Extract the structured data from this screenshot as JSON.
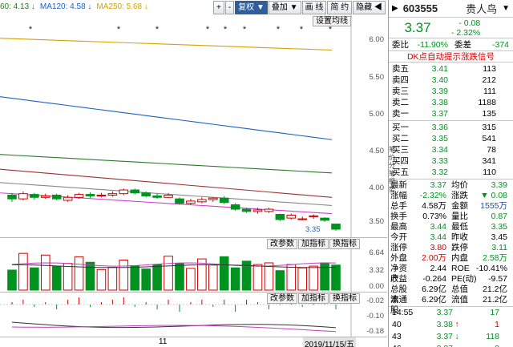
{
  "ma_legend": [
    {
      "label": "60: 4.13 ↓",
      "color": "#2b7a2b"
    },
    {
      "label": "MA120: 4.58 ↓",
      "color": "#1f60c8"
    },
    {
      "label": "MA250: 5.68 ↓",
      "color": "#d8a000"
    }
  ],
  "toolbar": [
    {
      "label": "+",
      "active": false
    },
    {
      "label": "-",
      "active": false
    },
    {
      "label": "复权 ▼",
      "active": true
    },
    {
      "label": "叠加 ▼",
      "active": false
    },
    {
      "label": "画 线",
      "active": false
    },
    {
      "label": "简 约",
      "active": false
    },
    {
      "label": "隐藏 ◀",
      "active": false
    }
  ],
  "setting_button": "设置均线",
  "price_axis": [
    "6.00",
    "5.50",
    "5.00",
    "4.50",
    "4.00",
    "3.50"
  ],
  "last_price_marker": "3.35",
  "panel_buttons": [
    "改参数",
    "加指标",
    "换指标"
  ],
  "volume_axis": [
    "6.64",
    "3.32",
    "0.00"
  ],
  "macd_axis": [
    "-0.02",
    "-0.10",
    "-0.18"
  ],
  "bottom_axis": {
    "left_label": "11",
    "date_label": "2019/11/15/五"
  },
  "stars": [
    38,
    148,
    196,
    259,
    281,
    305,
    347,
    376,
    412
  ],
  "stock": {
    "code": "603555",
    "name": "贵人鸟",
    "price": "3.37",
    "change": "- 0.08",
    "change_pct": "- 2.32%"
  },
  "committee": {
    "ratio_label": "委比",
    "ratio_value": "-11.90%",
    "diff_label": "委差",
    "diff_value": "-374"
  },
  "signal_link": "DK点自动提示涨跌信号",
  "asks": [
    {
      "label": "卖五",
      "price": "3.41",
      "volume": "113"
    },
    {
      "label": "卖四",
      "price": "3.40",
      "volume": "212"
    },
    {
      "label": "卖三",
      "price": "3.39",
      "volume": "111"
    },
    {
      "label": "卖二",
      "price": "3.38",
      "volume": "1188"
    },
    {
      "label": "卖一",
      "price": "3.37",
      "volume": "135"
    }
  ],
  "bids": [
    {
      "label": "买一",
      "price": "3.36",
      "volume": "315"
    },
    {
      "label": "买二",
      "price": "3.35",
      "volume": "541"
    },
    {
      "label": "买三",
      "price": "3.34",
      "volume": "78"
    },
    {
      "label": "买四",
      "price": "3.33",
      "volume": "341"
    },
    {
      "label": "买五",
      "price": "3.32",
      "volume": "110"
    }
  ],
  "stats": [
    {
      "l1": "最新",
      "v1": "3.37",
      "c1": "green",
      "l2": "均价",
      "v2": "3.39",
      "c2": "green"
    },
    {
      "l1": "涨幅",
      "v1": "-2.32%",
      "c1": "green",
      "l2": "涨跌",
      "v2": "▼ 0.08",
      "c2": "green"
    },
    {
      "l1": "总手",
      "v1": "4.58万",
      "c1": "",
      "l2": "金额",
      "v2": "1555万",
      "c2": "blue"
    },
    {
      "l1": "换手",
      "v1": "0.73%",
      "c1": "",
      "l2": "量比",
      "v2": "0.87",
      "c2": "green"
    },
    {
      "l1": "最高",
      "v1": "3.44",
      "c1": "green",
      "l2": "最低",
      "v2": "3.35",
      "c2": "green"
    },
    {
      "l1": "今开",
      "v1": "3.44",
      "c1": "green",
      "l2": "昨收",
      "v2": "3.45",
      "c2": ""
    },
    {
      "l1": "涨停",
      "v1": "3.80",
      "c1": "red",
      "l2": "跌停",
      "v2": "3.11",
      "c2": "green"
    },
    {
      "l1": "外盘",
      "v1": "2.00万",
      "c1": "red",
      "l2": "内盘",
      "v2": "2.58万",
      "c2": "green"
    },
    {
      "l1": "净资产",
      "v1": "2.44",
      "c1": "",
      "l2": "ROE",
      "v2": "-10.41%",
      "c2": ""
    },
    {
      "l1": "收益",
      "v1": "-0.264",
      "c1": "",
      "l2": "PE(动)",
      "v2": "-9.57",
      "c2": ""
    },
    {
      "l1": "总股本",
      "v1": "6.29亿",
      "c1": "",
      "l2": "总值",
      "v2": "21.2亿",
      "c2": ""
    },
    {
      "l1": "流通股",
      "v1": "6.29亿",
      "c1": "",
      "l2": "流值",
      "v2": "21.2亿",
      "c2": ""
    }
  ],
  "ticks": [
    {
      "time": "14:55",
      "price": "3.37",
      "price_color": "green",
      "arrow": "",
      "arrow_color": "",
      "volume": "17",
      "vol_color": "green"
    },
    {
      "time": "40",
      "price": "3.38",
      "price_color": "green",
      "arrow": "↑",
      "arrow_color": "red",
      "volume": "1",
      "vol_color": "red"
    },
    {
      "time": "43",
      "price": "3.37",
      "price_color": "green",
      "arrow": "↓",
      "arrow_color": "green",
      "volume": "118",
      "vol_color": "green"
    },
    {
      "time": "46",
      "price": "3.37",
      "price_color": "green",
      "arrow": "",
      "arrow_color": "",
      "volume": "2",
      "vol_color": "green"
    }
  ],
  "side_tabs": [
    "笔",
    "价",
    "分",
    "笔",
    "细",
    "势"
  ],
  "chart_data": {
    "type": "candlestick",
    "candles": [
      {
        "o": 3.83,
        "c": 3.78,
        "h": 3.86,
        "l": 3.74
      },
      {
        "o": 3.78,
        "c": 3.85,
        "h": 3.88,
        "l": 3.76
      },
      {
        "o": 3.84,
        "c": 3.8,
        "h": 3.86,
        "l": 3.77
      },
      {
        "o": 3.8,
        "c": 3.82,
        "h": 3.85,
        "l": 3.78
      },
      {
        "o": 3.83,
        "c": 3.78,
        "h": 3.85,
        "l": 3.76
      },
      {
        "o": 3.76,
        "c": 3.8,
        "h": 3.83,
        "l": 3.74
      },
      {
        "o": 3.8,
        "c": 3.84,
        "h": 3.86,
        "l": 3.78
      },
      {
        "o": 3.84,
        "c": 3.82,
        "h": 3.87,
        "l": 3.79
      },
      {
        "o": 3.82,
        "c": 3.83,
        "h": 3.86,
        "l": 3.8
      },
      {
        "o": 3.83,
        "c": 3.85,
        "h": 3.88,
        "l": 3.81
      },
      {
        "o": 3.85,
        "c": 3.9,
        "h": 3.92,
        "l": 3.83
      },
      {
        "o": 3.9,
        "c": 3.86,
        "h": 3.92,
        "l": 3.84
      },
      {
        "o": 3.86,
        "c": 3.82,
        "h": 3.88,
        "l": 3.8
      },
      {
        "o": 3.82,
        "c": 3.8,
        "h": 3.85,
        "l": 3.78
      },
      {
        "o": 3.8,
        "c": 3.83,
        "h": 3.86,
        "l": 3.79
      },
      {
        "o": 3.78,
        "c": 3.72,
        "h": 3.8,
        "l": 3.7
      },
      {
        "o": 3.72,
        "c": 3.75,
        "h": 3.78,
        "l": 3.7
      },
      {
        "o": 3.74,
        "c": 3.77,
        "h": 3.8,
        "l": 3.72
      },
      {
        "o": 3.77,
        "c": 3.79,
        "h": 3.8,
        "l": 3.74
      },
      {
        "o": 3.79,
        "c": 3.73,
        "h": 3.82,
        "l": 3.71
      },
      {
        "o": 3.7,
        "c": 3.64,
        "h": 3.72,
        "l": 3.62
      },
      {
        "o": 3.64,
        "c": 3.61,
        "h": 3.66,
        "l": 3.59
      },
      {
        "o": 3.61,
        "c": 3.63,
        "h": 3.66,
        "l": 3.58
      },
      {
        "o": 3.61,
        "c": 3.64,
        "h": 3.66,
        "l": 3.59
      },
      {
        "o": 3.57,
        "c": 3.5,
        "h": 3.58,
        "l": 3.48
      },
      {
        "o": 3.52,
        "c": 3.56,
        "h": 3.58,
        "l": 3.5
      },
      {
        "o": 3.5,
        "c": 3.51,
        "h": 3.54,
        "l": 3.49
      },
      {
        "o": 3.54,
        "c": 3.55,
        "h": 3.57,
        "l": 3.51
      },
      {
        "o": 3.52,
        "c": 3.49,
        "h": 3.53,
        "l": 3.47
      },
      {
        "o": 3.44,
        "c": 3.37,
        "h": 3.44,
        "l": 3.35
      }
    ],
    "ma_lines": [
      {
        "name": "MA250",
        "color": "#d8a000",
        "values": [
          5.95,
          5.79
        ]
      },
      {
        "name": "MA120",
        "color": "#1f60c8",
        "values": [
          5.16,
          4.58
        ]
      },
      {
        "name": "MA60",
        "color": "#2b7a2b",
        "values": [
          4.38,
          4.13
        ]
      },
      {
        "name": "MA30",
        "color": "#a03030",
        "values": [
          4.18,
          3.8
        ]
      },
      {
        "name": "MA20",
        "color": "#888888",
        "values": [
          4.0,
          3.69
        ]
      },
      {
        "name": "MA10",
        "color": "#d040d0",
        "values": [
          3.86,
          3.58
        ]
      }
    ],
    "ylim": [
      3.37,
      6.12
    ],
    "volume": [
      3.6,
      6.6,
      4.0,
      6.3,
      4.3,
      4.8,
      6.0,
      5.0,
      3.7,
      4.1,
      5.4,
      4.4,
      3.8,
      4.6,
      6.1,
      4.8,
      3.9,
      5.6,
      4.5,
      6.0,
      4.0,
      5.2,
      4.6,
      4.9,
      3.5,
      4.6,
      4.0,
      4.3,
      4.9,
      4.5
    ],
    "volume_ylim": [
      0,
      7.2
    ],
    "macd": [
      0.01,
      0.02,
      -0.01,
      0.01,
      -0.02,
      0.02,
      0.03,
      -0.01,
      0.01,
      0.02,
      0.03,
      -0.01,
      0.01,
      -0.02,
      0.02,
      -0.03,
      0.01,
      0.02,
      -0.01,
      0.02,
      -0.03,
      0.02,
      0.01,
      -0.02,
      0.03,
      0.01,
      -0.01,
      0.02,
      0.03,
      -0.02
    ]
  }
}
